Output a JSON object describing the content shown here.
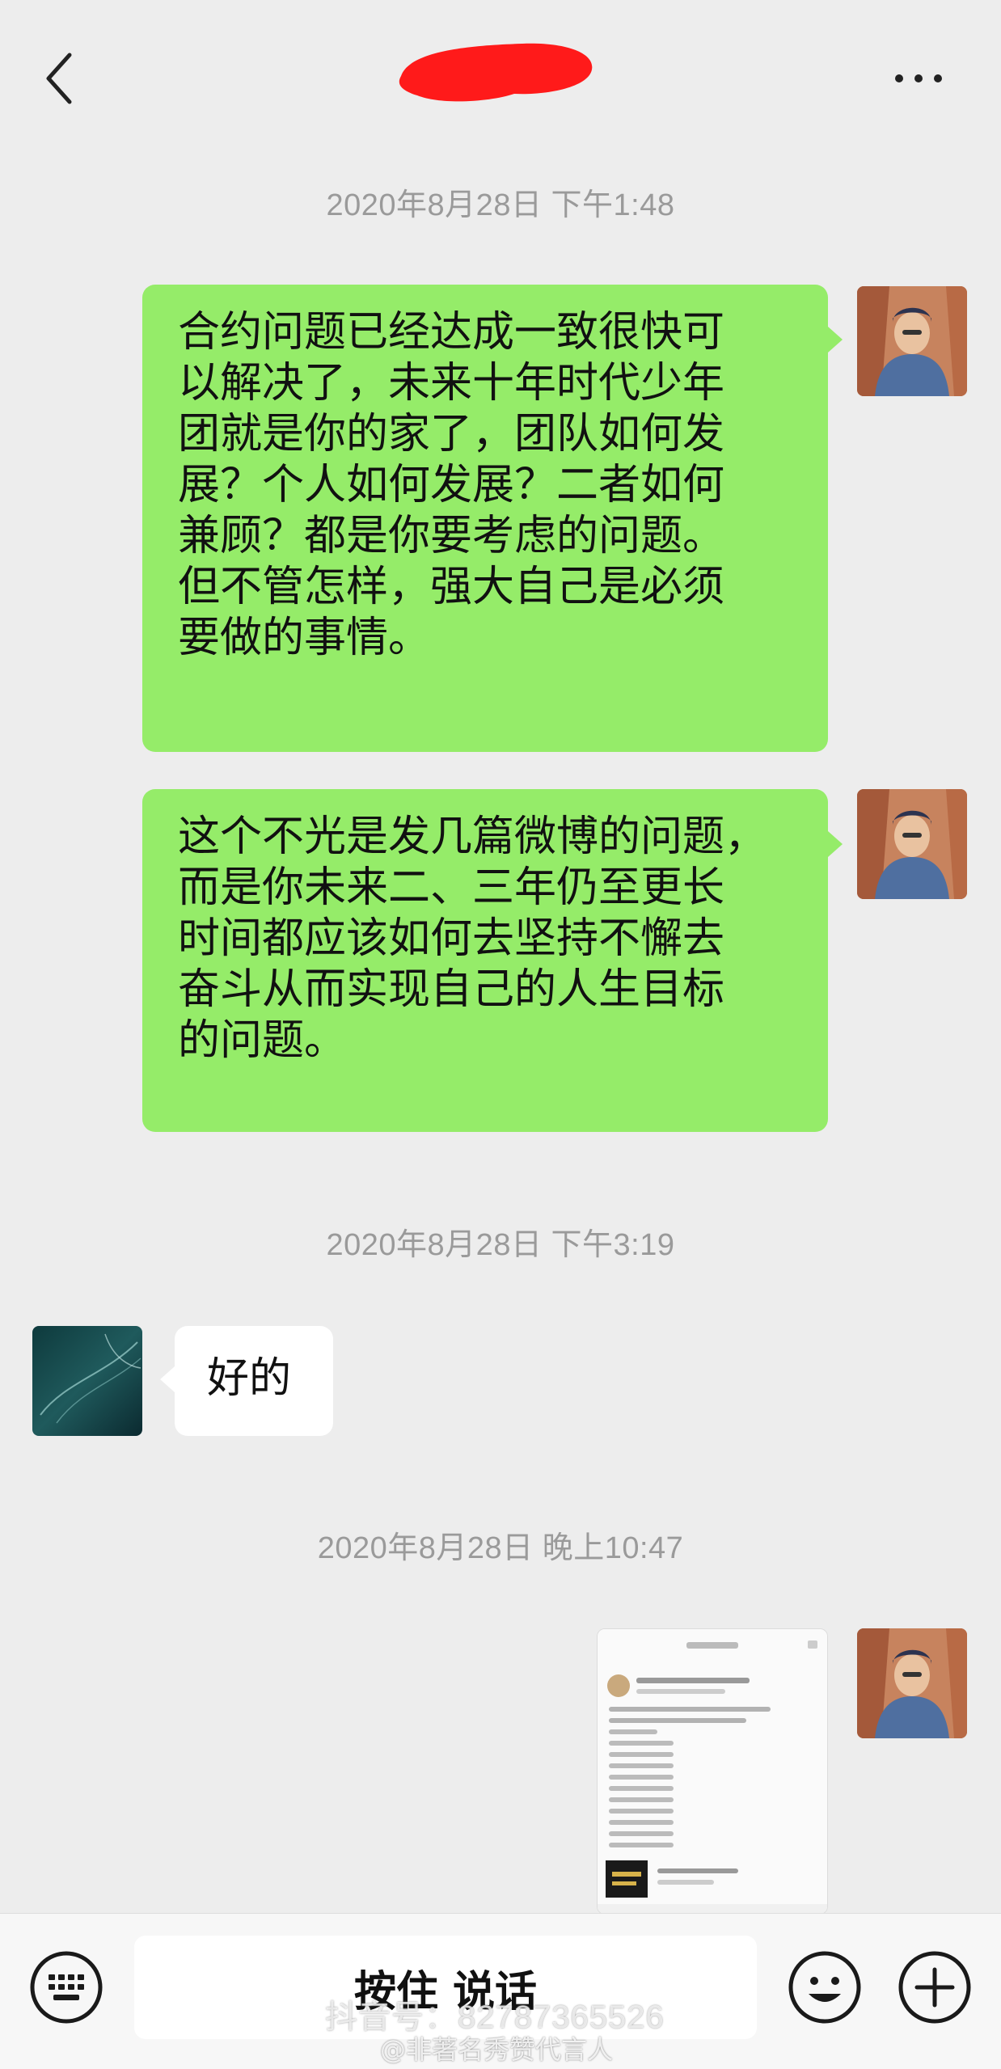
{
  "header": {
    "back_icon": "chevron-left-icon",
    "title_redacted": true,
    "more_icon": "ellipsis-icon"
  },
  "timestamps": {
    "first": "2020年8月28日 下午1:48",
    "second": "2020年8月28日 下午3:19",
    "third": "2020年8月28日 晚上10:47"
  },
  "messages": {
    "msg1": {
      "sender": "self",
      "lines": [
        "合约问题已经达成一致很快可",
        "以解决了，未来十年时代少年",
        "团就是你的家了，团队如何发",
        "展？个人如何发展？二者如何",
        "兼顾？都是你要考虑的问题。",
        "但不管怎样，强大自己是必须",
        "要做的事情。"
      ]
    },
    "msg2": {
      "sender": "self",
      "lines": [
        "这个不光是发几篇微博的问题，",
        "而是你未来二、三年仍至更长",
        "时间都应该如何去坚持不懈去",
        "奋斗从而实现自己的人生目标",
        "的问题。"
      ]
    },
    "msg3": {
      "sender": "other",
      "text": "好的"
    },
    "msg4": {
      "sender": "self",
      "type": "image"
    }
  },
  "bottom_bar": {
    "keyboard_icon": "keyboard-icon",
    "hold_to_talk": "按住 说话",
    "emoji_icon": "emoji-icon",
    "plus_icon": "plus-icon"
  },
  "watermarks": {
    "douyin": "抖音号：82787365526",
    "weibo": "@非著名秀赞代言人"
  },
  "colors": {
    "background": "#ededed",
    "bubble_green": "#95ec69",
    "bubble_white": "#ffffff",
    "timestamp": "#9a9a9a",
    "redaction": "#ff1a1a"
  }
}
